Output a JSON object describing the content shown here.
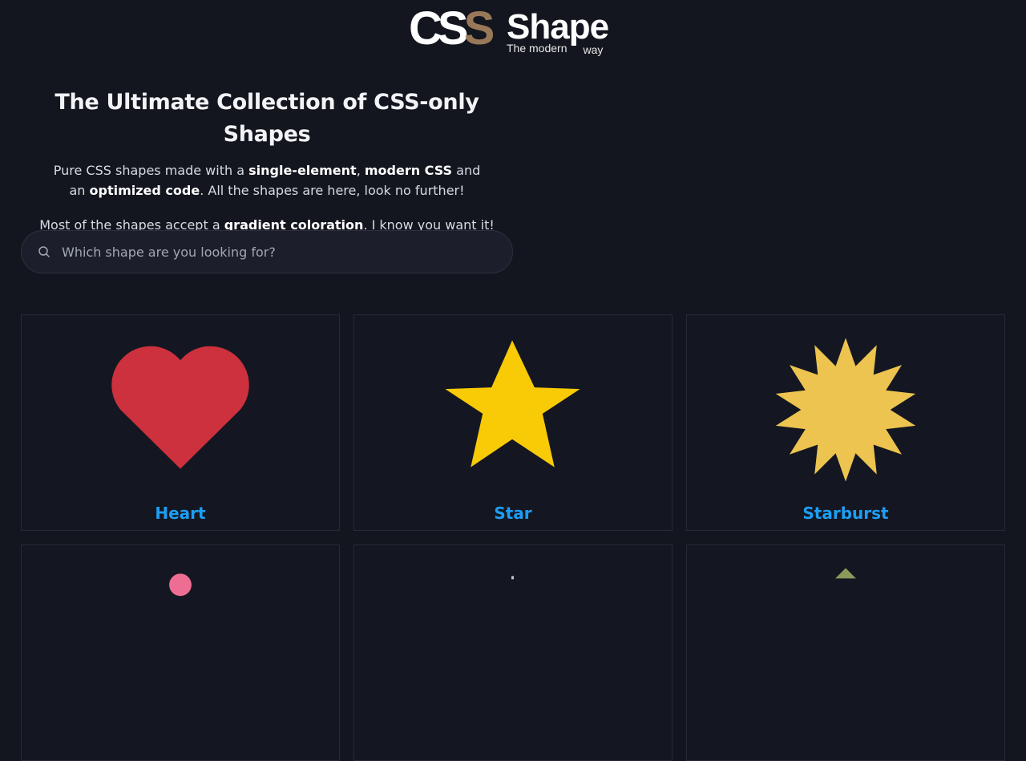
{
  "header": {
    "logo_css": "CS",
    "logo_css_faded": "S",
    "logo_word": "Shape",
    "tagline_part1": "The modern",
    "tagline_part2": "way"
  },
  "intro": {
    "title": "The Ultimate Collection of CSS-only Shapes",
    "p1_text1": "Pure CSS shapes made with a ",
    "p1_bold1": "single-element",
    "p1_text2": ", ",
    "p1_bold2": "modern CSS",
    "p1_text3": " and",
    "p1_text4": "an ",
    "p1_bold3": "optimized code",
    "p1_text5": ". All the shapes are here, look no further!",
    "p2_text1": "Most of the shapes accept a ",
    "p2_bold1": "gradient coloration",
    "p2_text2": ". I know you want it!"
  },
  "search": {
    "placeholder": "Which shape are you looking for?",
    "value": ""
  },
  "shapes": [
    {
      "label": "Heart",
      "color": "#cc313d"
    },
    {
      "label": "Star",
      "color": "#f9ca06"
    },
    {
      "label": "Starburst",
      "color": "#ecc44f"
    }
  ],
  "partial_shapes": [
    {
      "color": "#ee6e93"
    },
    {
      "color": "#c1c5cc"
    },
    {
      "color": "#8a9a5b"
    }
  ],
  "colors": {
    "background": "#14161f",
    "link": "#1e9df3",
    "card_border": "#262a36"
  }
}
